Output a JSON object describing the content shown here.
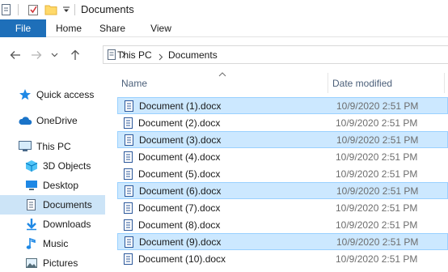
{
  "window": {
    "title": "Documents"
  },
  "ribbon": {
    "tabs": [
      "File",
      "Home",
      "Share",
      "View"
    ]
  },
  "address": {
    "crumbs": [
      "This PC",
      "Documents"
    ]
  },
  "nav": {
    "items": [
      {
        "label": "Quick access",
        "icon": "star-icon"
      },
      {
        "label": "OneDrive",
        "icon": "cloud-icon"
      },
      {
        "label": "This PC",
        "icon": "computer-icon"
      },
      {
        "label": "3D Objects",
        "icon": "cube-icon"
      },
      {
        "label": "Desktop",
        "icon": "desktop-icon"
      },
      {
        "label": "Documents",
        "icon": "documents-icon",
        "selected": true
      },
      {
        "label": "Downloads",
        "icon": "download-icon"
      },
      {
        "label": "Music",
        "icon": "music-icon"
      },
      {
        "label": "Pictures",
        "icon": "pictures-icon"
      }
    ]
  },
  "files": {
    "columns": {
      "name": "Name",
      "date": "Date modified"
    },
    "rows": [
      {
        "name": "Document (1).docx",
        "date": "10/9/2020 2:51 PM",
        "selected": true
      },
      {
        "name": "Document (2).docx",
        "date": "10/9/2020 2:51 PM",
        "selected": false
      },
      {
        "name": "Document (3).docx",
        "date": "10/9/2020 2:51 PM",
        "selected": true
      },
      {
        "name": "Document (4).docx",
        "date": "10/9/2020 2:51 PM",
        "selected": false
      },
      {
        "name": "Document (5).docx",
        "date": "10/9/2020 2:51 PM",
        "selected": false
      },
      {
        "name": "Document (6).docx",
        "date": "10/9/2020 2:51 PM",
        "selected": true
      },
      {
        "name": "Document (7).docx",
        "date": "10/9/2020 2:51 PM",
        "selected": false
      },
      {
        "name": "Document (8).docx",
        "date": "10/9/2020 2:51 PM",
        "selected": false
      },
      {
        "name": "Document (9).docx",
        "date": "10/9/2020 2:51 PM",
        "selected": true
      },
      {
        "name": "Document (10).docx",
        "date": "10/9/2020 2:51 PM",
        "selected": false
      }
    ]
  },
  "colors": {
    "accent": "#1e6fb9",
    "selection": "#cce8ff",
    "selection_border": "#99d1ff",
    "nav_selected": "#cce4f7"
  }
}
